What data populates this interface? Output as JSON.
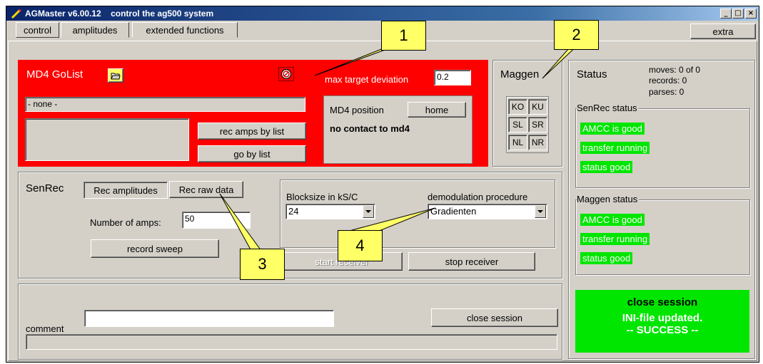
{
  "window": {
    "title": "AGMaster v6.00.12    control the ag500 system",
    "controls": [
      "_",
      "□",
      "×"
    ]
  },
  "tabs": [
    {
      "label": "control",
      "active": true
    },
    {
      "label": "amplitudes",
      "active": false
    },
    {
      "label": "extended functions",
      "active": false
    }
  ],
  "extra_button": "extra",
  "md4": {
    "golist_title": "MD4 GoList",
    "max_target_label": "max target deviation",
    "max_target_value": "0.2",
    "list_value": "- none -",
    "rec_amps_button": "rec amps by list",
    "go_button": "go by list",
    "position_label": "MD4 position",
    "home_button": "home",
    "contact_status": "no contact to md4"
  },
  "maggen": {
    "title": "Maggen",
    "buttons": [
      "KO",
      "KU",
      "SL",
      "SR",
      "NL",
      "NR"
    ]
  },
  "status": {
    "title": "Status",
    "moves": "moves: 0 of 0",
    "records": "records: 0",
    "parses": "parses: 0",
    "senrec_title": "SenRec status",
    "senrec_items": [
      "AMCC is good",
      "transfer running",
      "status good"
    ],
    "maggen_title": "Maggen status",
    "maggen_items": [
      "AMCC is good",
      "transfer running",
      "status good"
    ],
    "session_line1": "close session",
    "session_line2": "INI-file updated.",
    "session_line3": "-- SUCCESS --"
  },
  "senrec": {
    "title": "SenRec",
    "rec_amplitudes": "Rec amplitudes",
    "rec_raw": "Rec raw data",
    "num_amps_label": "Number of amps:",
    "num_amps_value": "50",
    "record_sweep": "record sweep",
    "blocksize_label": "Blocksize in kS/C",
    "blocksize_value": "24",
    "demod_label": "demodulation procedure",
    "demod_value": "Gradienten",
    "start_receiver": "start receiver",
    "stop_receiver": "stop receiver"
  },
  "session": {
    "comment_label": "comment",
    "comment_value": "",
    "close_button": "close session"
  },
  "callouts": [
    "1",
    "2",
    "3",
    "4"
  ],
  "colors": {
    "accent_red": "#ff0000",
    "status_green": "#00e600",
    "callout_yellow": "#ffff66"
  }
}
